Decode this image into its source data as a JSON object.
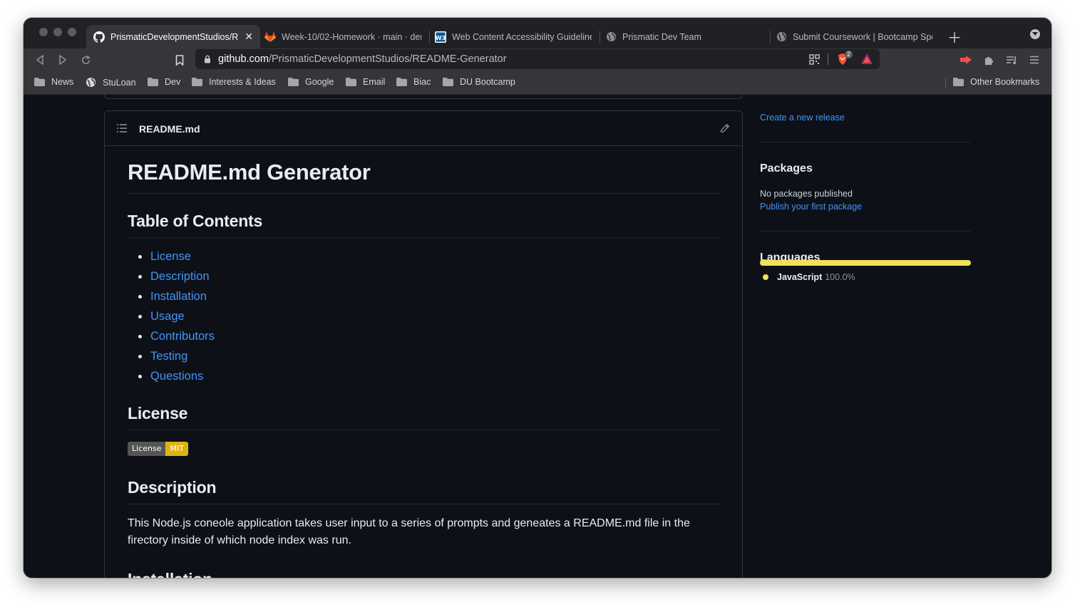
{
  "browser": {
    "tabs": [
      {
        "label": "PrismaticDevelopmentStudios/R",
        "icon": "github-icon",
        "active": true
      },
      {
        "label": "Week-10/02-Homework · main · den",
        "icon": "gitlab-icon",
        "active": false
      },
      {
        "label": "Web Content Accessibility Guideline",
        "icon": "w3c-icon",
        "active": false
      },
      {
        "label": "Prismatic Dev Team",
        "icon": "globe-icon",
        "active": false
      },
      {
        "label": "Submit Coursework | Bootcamp Spo",
        "icon": "globe-icon",
        "active": false
      }
    ],
    "address": {
      "domain": "github.com",
      "path": "/PrismaticDevelopmentStudios/README-Generator",
      "shield_count": "2"
    },
    "bookmarks": [
      {
        "label": "News",
        "icon": "folder-icon"
      },
      {
        "label": "StuLoan",
        "icon": "globe-icon"
      },
      {
        "label": "Dev",
        "icon": "folder-icon"
      },
      {
        "label": "Interests & Ideas",
        "icon": "folder-icon"
      },
      {
        "label": "Google",
        "icon": "folder-icon"
      },
      {
        "label": "Email",
        "icon": "folder-icon"
      },
      {
        "label": "Biac",
        "icon": "folder-icon"
      },
      {
        "label": "DU Bootcamp",
        "icon": "folder-icon"
      }
    ],
    "other_bookmarks": "Other Bookmarks"
  },
  "readme": {
    "filename": "README.md",
    "title": "README.md Generator",
    "toc_heading": "Table of Contents",
    "toc": [
      "License",
      "Description",
      "Installation",
      "Usage",
      "Contributors",
      "Testing",
      "Questions"
    ],
    "license_heading": "License",
    "badge": {
      "left": "License",
      "right": "MIT",
      "color": "#dfb317"
    },
    "description_heading": "Description",
    "description": "This Node.js coneole application takes user input to a series of prompts and geneates a README.md file in the firectory inside of which node index was run.",
    "next_heading": "Installation"
  },
  "sidebar": {
    "release_link": "Create a new release",
    "packages_heading": "Packages",
    "packages_status": "No packages published",
    "packages_link": "Publish your first package",
    "languages_heading": "Languages",
    "languages": [
      {
        "name": "JavaScript",
        "percent": "100.0%",
        "fraction": 1.0,
        "color": "#f1e05a"
      }
    ]
  },
  "colors": {
    "link": "#4493f8",
    "page_bg": "#0d1117",
    "border": "#30363d"
  }
}
